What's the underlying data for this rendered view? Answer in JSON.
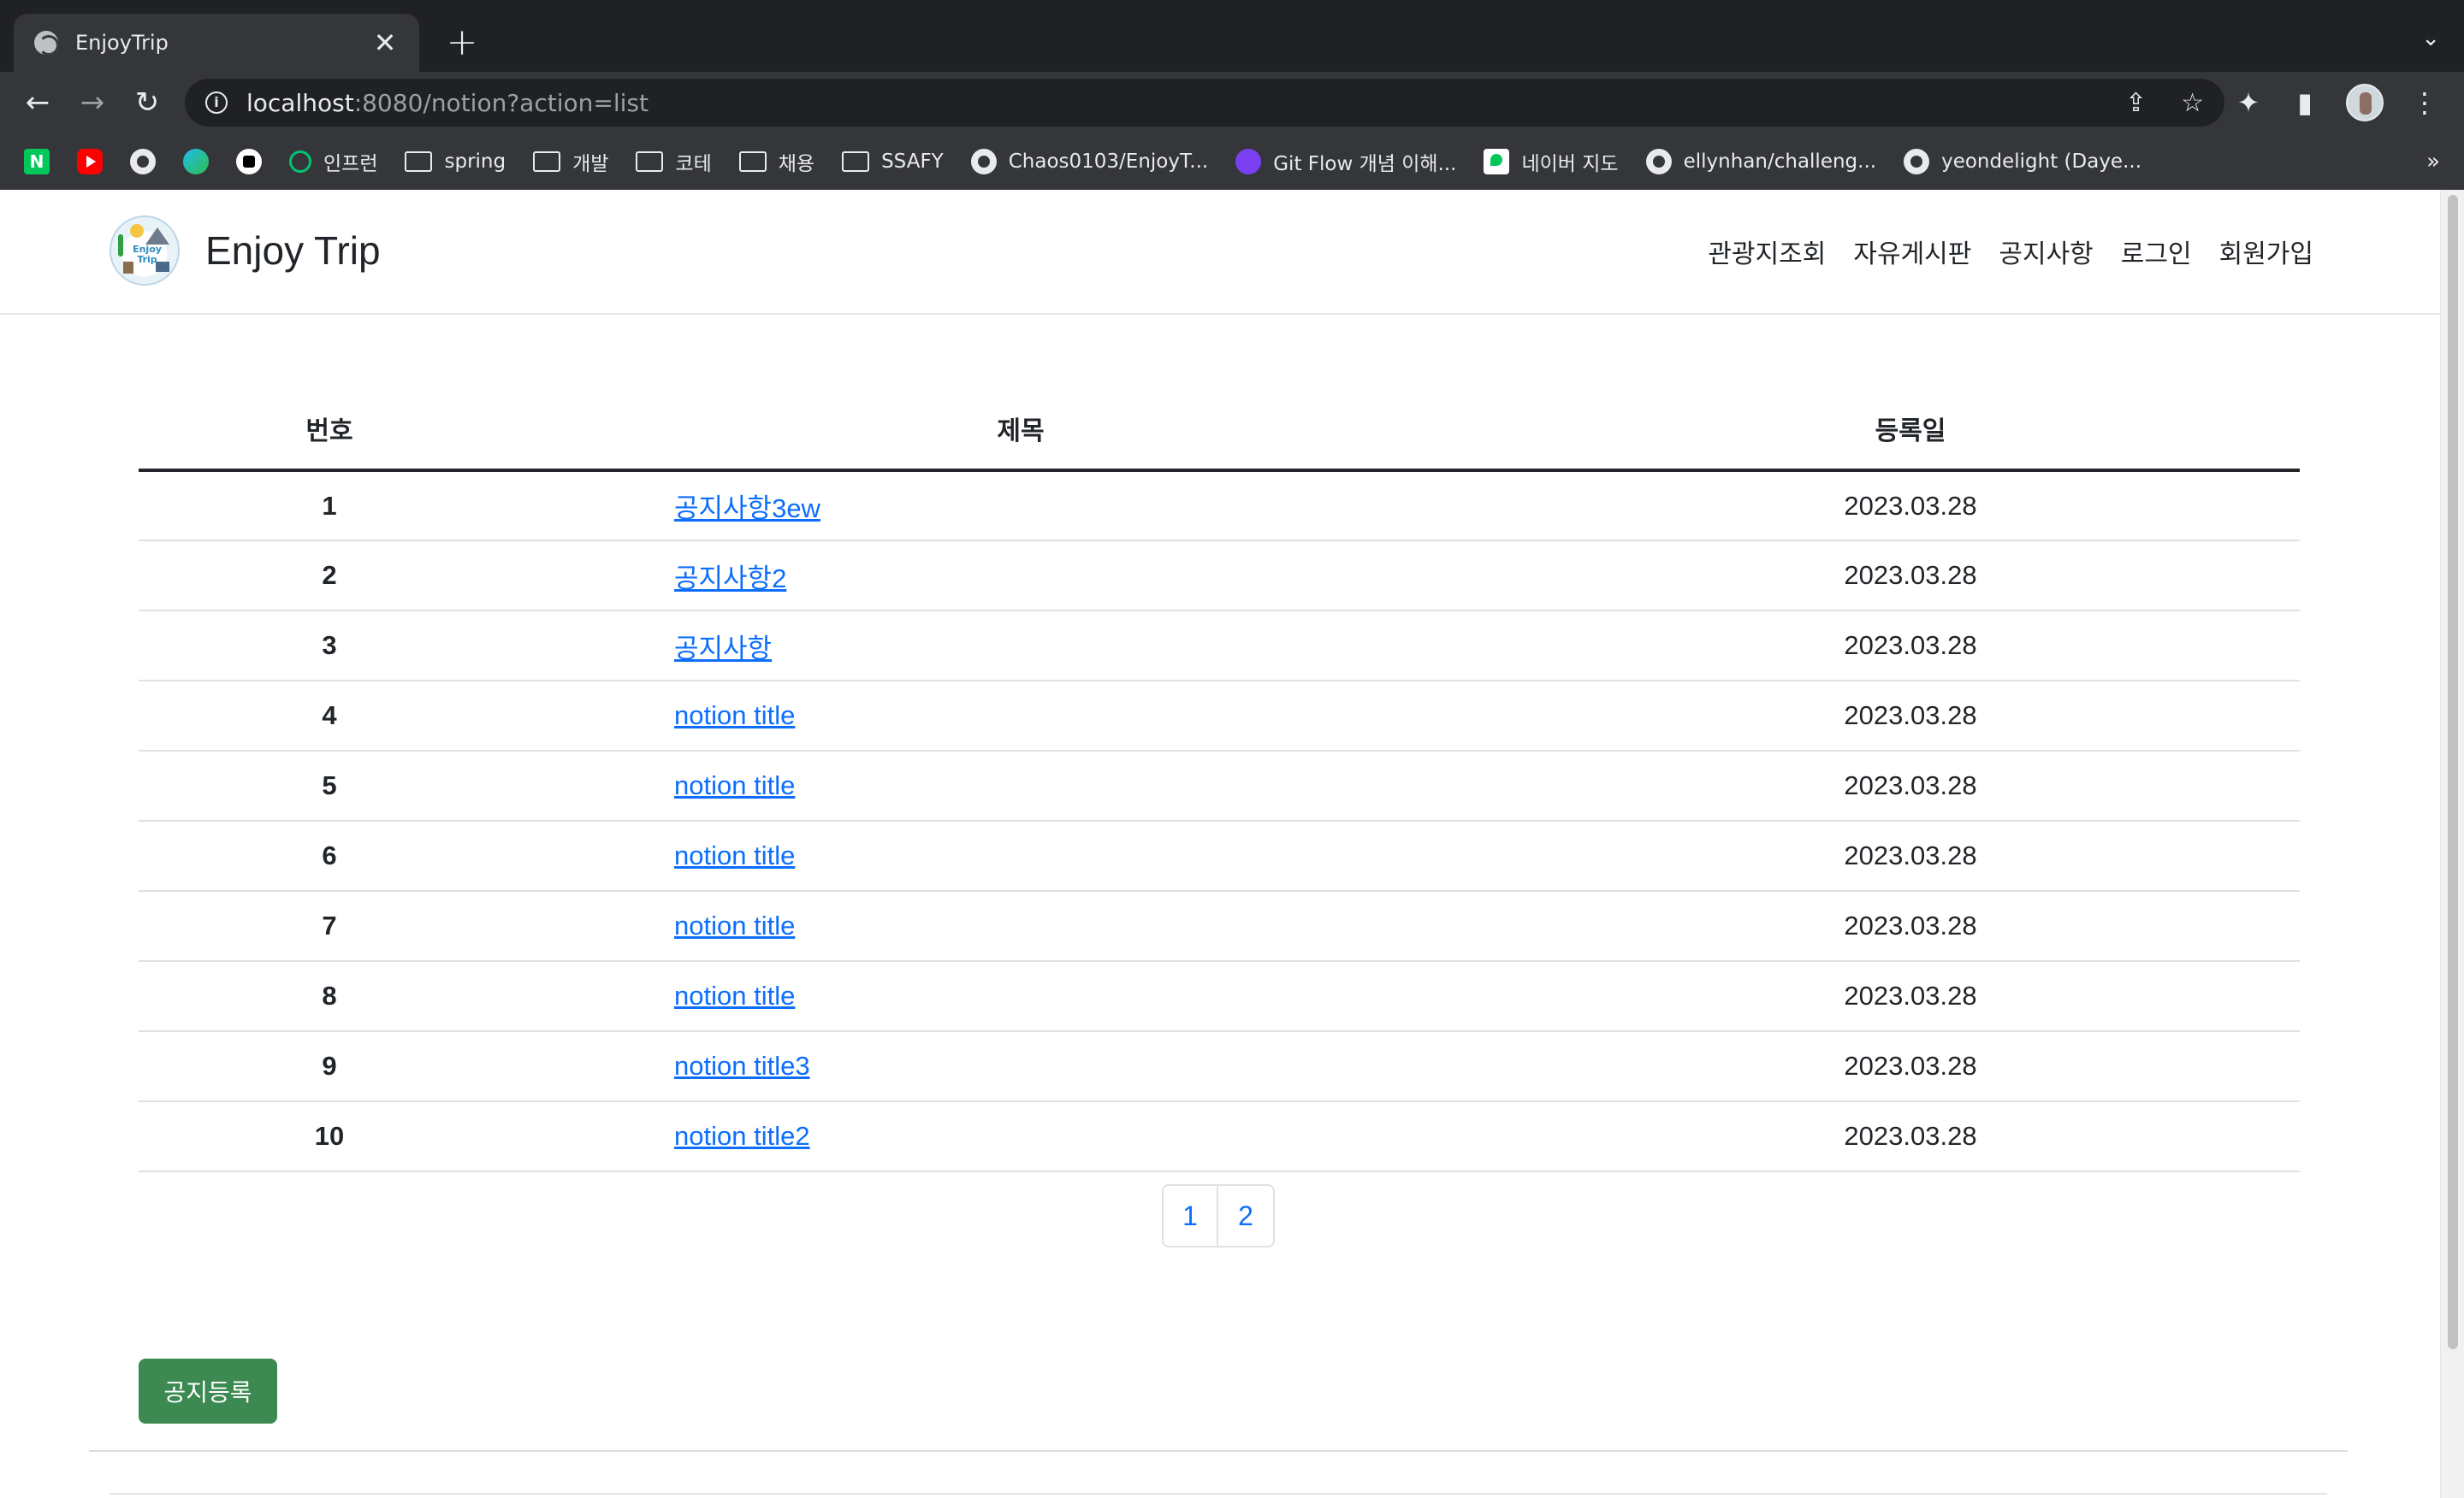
{
  "browser": {
    "tab_title": "EnjoyTrip",
    "tab_close": "✕",
    "new_tab": "+",
    "tab_menu": "⌄",
    "url_host": "localhost",
    "url_rest": ":8080/notion?action=list",
    "info_icon": "i",
    "bookmarks": [
      {
        "icon": "naver-icon",
        "label": ""
      },
      {
        "icon": "youtube-icon",
        "label": ""
      },
      {
        "icon": "github-icon",
        "label": ""
      },
      {
        "icon": "edge-icon",
        "label": ""
      },
      {
        "icon": "notion-icon",
        "label": ""
      },
      {
        "icon": "inflearn-icon",
        "label": "인프런"
      },
      {
        "icon": "folder-icon",
        "label": "spring"
      },
      {
        "icon": "folder-icon",
        "label": "개발"
      },
      {
        "icon": "folder-icon",
        "label": "코테"
      },
      {
        "icon": "folder-icon",
        "label": "채용"
      },
      {
        "icon": "folder-icon",
        "label": "SSAFY"
      },
      {
        "icon": "github-icon",
        "label": "Chaos0103/EnjoyT..."
      },
      {
        "icon": "gitflow-icon",
        "label": "Git Flow 개념 이해..."
      },
      {
        "icon": "naver-map-icon",
        "label": "네이버 지도"
      },
      {
        "icon": "github-icon",
        "label": "ellynhan/challeng..."
      },
      {
        "icon": "github-icon",
        "label": "yeondelight (Daye..."
      }
    ],
    "bookmarks_more": "»"
  },
  "header": {
    "brand": "Enjoy Trip",
    "logo_text": "Enjoy Trip",
    "nav": [
      "관광지조회",
      "자유게시판",
      "공지사항",
      "로그인",
      "회원가입"
    ]
  },
  "table": {
    "columns": [
      "번호",
      "제목",
      "등록일"
    ],
    "rows": [
      {
        "num": "1",
        "title": "공지사항3ew",
        "date": "2023.03.28"
      },
      {
        "num": "2",
        "title": "공지사항2",
        "date": "2023.03.28"
      },
      {
        "num": "3",
        "title": "공지사항",
        "date": "2023.03.28"
      },
      {
        "num": "4",
        "title": "notion title",
        "date": "2023.03.28"
      },
      {
        "num": "5",
        "title": "notion title",
        "date": "2023.03.28"
      },
      {
        "num": "6",
        "title": "notion title",
        "date": "2023.03.28"
      },
      {
        "num": "7",
        "title": "notion title",
        "date": "2023.03.28"
      },
      {
        "num": "8",
        "title": "notion title",
        "date": "2023.03.28"
      },
      {
        "num": "9",
        "title": "notion title3",
        "date": "2023.03.28"
      },
      {
        "num": "10",
        "title": "notion title2",
        "date": "2023.03.28"
      }
    ]
  },
  "pagination": [
    "1",
    "2"
  ],
  "actions": {
    "register_label": "공지등록"
  },
  "colors": {
    "link": "#0d6efd",
    "register_button": "#3c8a52",
    "chrome_dark": "#202124",
    "chrome_toolbar": "#35363a"
  }
}
